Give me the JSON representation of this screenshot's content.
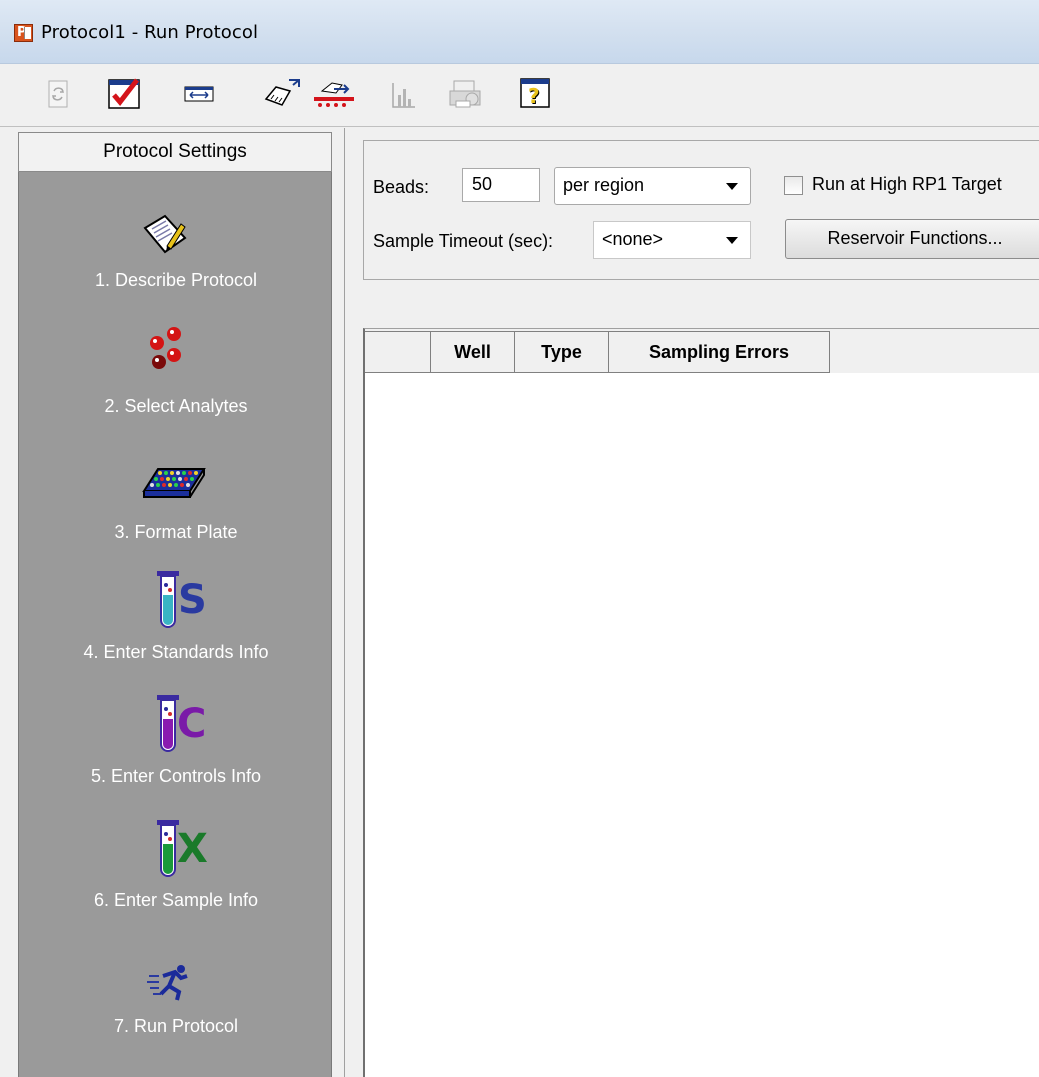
{
  "window": {
    "title": "Protocol1 - Run Protocol",
    "app_icon_letter": "P"
  },
  "toolbar": {
    "buttons": [
      {
        "name": "refresh-icon",
        "enabled": false
      },
      {
        "name": "validate-checkmark-icon",
        "enabled": true
      },
      {
        "name": "resize-columns-icon",
        "enabled": true
      },
      {
        "name": "load-plate-icon",
        "enabled": true
      },
      {
        "name": "eject-plate-icon",
        "enabled": true
      },
      {
        "name": "chart-icon",
        "enabled": false
      },
      {
        "name": "print-icon",
        "enabled": false
      },
      {
        "name": "help-icon",
        "enabled": true
      }
    ]
  },
  "sidebar": {
    "header": "Protocol Settings",
    "steps": [
      {
        "label": "1. Describe Protocol",
        "icon": "notepad-pencil-icon"
      },
      {
        "label": "2. Select Analytes",
        "icon": "beads-icon"
      },
      {
        "label": "3. Format Plate",
        "icon": "plate-icon"
      },
      {
        "label": "4. Enter Standards Info",
        "icon": "tube-s-icon"
      },
      {
        "label": "5. Enter Controls Info",
        "icon": "tube-c-icon"
      },
      {
        "label": "6. Enter Sample Info",
        "icon": "tube-x-icon"
      },
      {
        "label": "7. Run Protocol",
        "icon": "runner-icon"
      }
    ]
  },
  "settings": {
    "beads_label": "Beads:",
    "beads_value": "50",
    "beads_unit": "per region",
    "high_rp1_label": "Run at High RP1 Target",
    "high_rp1_checked": false,
    "timeout_label": "Sample Timeout (sec):",
    "timeout_value": "<none>",
    "reservoir_button": "Reservoir Functions..."
  },
  "grid": {
    "columns": [
      "",
      "Well",
      "Type",
      "Sampling Errors"
    ],
    "rows": []
  },
  "colors": {
    "sidebar_bg": "#9a9a9a",
    "window_bg": "#f0f0f0"
  }
}
